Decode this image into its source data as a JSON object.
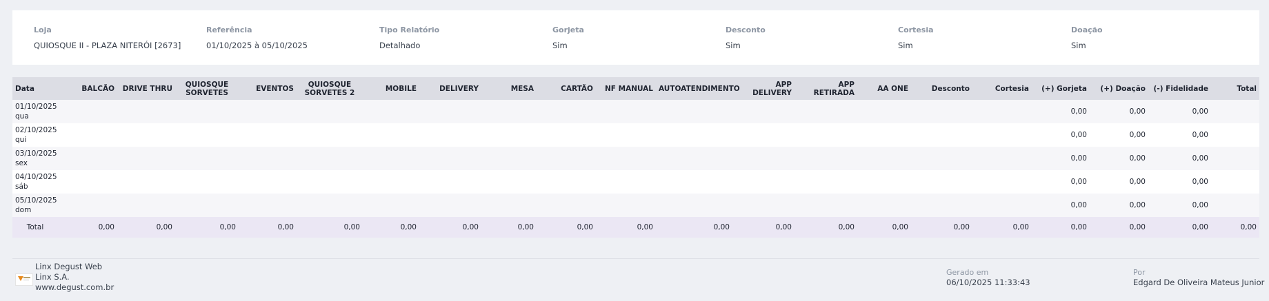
{
  "filters": [
    {
      "label": "Loja",
      "value": "QUIOSQUE II - PLAZA NITERÓI [2673]"
    },
    {
      "label": "Referência",
      "value": "01/10/2025 à 05/10/2025"
    },
    {
      "label": "Tipo Relatório",
      "value": "Detalhado"
    },
    {
      "label": "Gorjeta",
      "value": "Sim"
    },
    {
      "label": "Desconto",
      "value": "Sim"
    },
    {
      "label": "Cortesia",
      "value": "Sim"
    },
    {
      "label": "Doação",
      "value": "Sim"
    }
  ],
  "table": {
    "columns": [
      "Data",
      "BALCÃO",
      "DRIVE THRU",
      "QUIOSQUE SORVETES",
      "EVENTOS",
      "QUIOSQUE SORVETES 2",
      "MOBILE",
      "DELIVERY",
      "MESA",
      "CARTÃO",
      "NF MANUAL",
      "AUTOATENDIMENTO",
      "APP DELIVERY",
      "APP RETIRADA",
      "AA ONE",
      "Desconto",
      "Cortesia",
      "(+) Gorjeta",
      "(+) Doação",
      "(-) Fidelidade",
      "Total"
    ],
    "rows": [
      {
        "date": "01/10/2025",
        "day": "qua",
        "gorjeta": "0,00",
        "doacao": "0,00",
        "fidelidade": "0,00"
      },
      {
        "date": "02/10/2025",
        "day": "qui",
        "gorjeta": "0,00",
        "doacao": "0,00",
        "fidelidade": "0,00"
      },
      {
        "date": "03/10/2025",
        "day": "sex",
        "gorjeta": "0,00",
        "doacao": "0,00",
        "fidelidade": "0,00"
      },
      {
        "date": "04/10/2025",
        "day": "sáb",
        "gorjeta": "0,00",
        "doacao": "0,00",
        "fidelidade": "0,00"
      },
      {
        "date": "05/10/2025",
        "day": "dom",
        "gorjeta": "0,00",
        "doacao": "0,00",
        "fidelidade": "0,00"
      }
    ],
    "total_label": "Total",
    "totals": [
      "0,00",
      "0,00",
      "0,00",
      "0,00",
      "0,00",
      "0,00",
      "0,00",
      "0,00",
      "0,00",
      "0,00",
      "0,00",
      "0,00",
      "0,00",
      "0,00",
      "0,00",
      "0,00",
      "0,00",
      "0,00",
      "0,00",
      "0,00"
    ]
  },
  "footer": {
    "product": "Linx Degust Web",
    "company": "Linx S.A.",
    "website": "www.degust.com.br",
    "generated_label": "Gerado em",
    "generated_value": "06/10/2025 11:33:43",
    "by_label": "Por",
    "by_value": "Edgard De Oliveira Mateus Junior"
  },
  "colors": {
    "page_bg": "#eef0f4",
    "header_bg": "#dcdde4",
    "total_row_bg": "#ebe7f4",
    "label_gray": "#8d96a3"
  },
  "icons": {
    "logo": "degust-logo"
  }
}
